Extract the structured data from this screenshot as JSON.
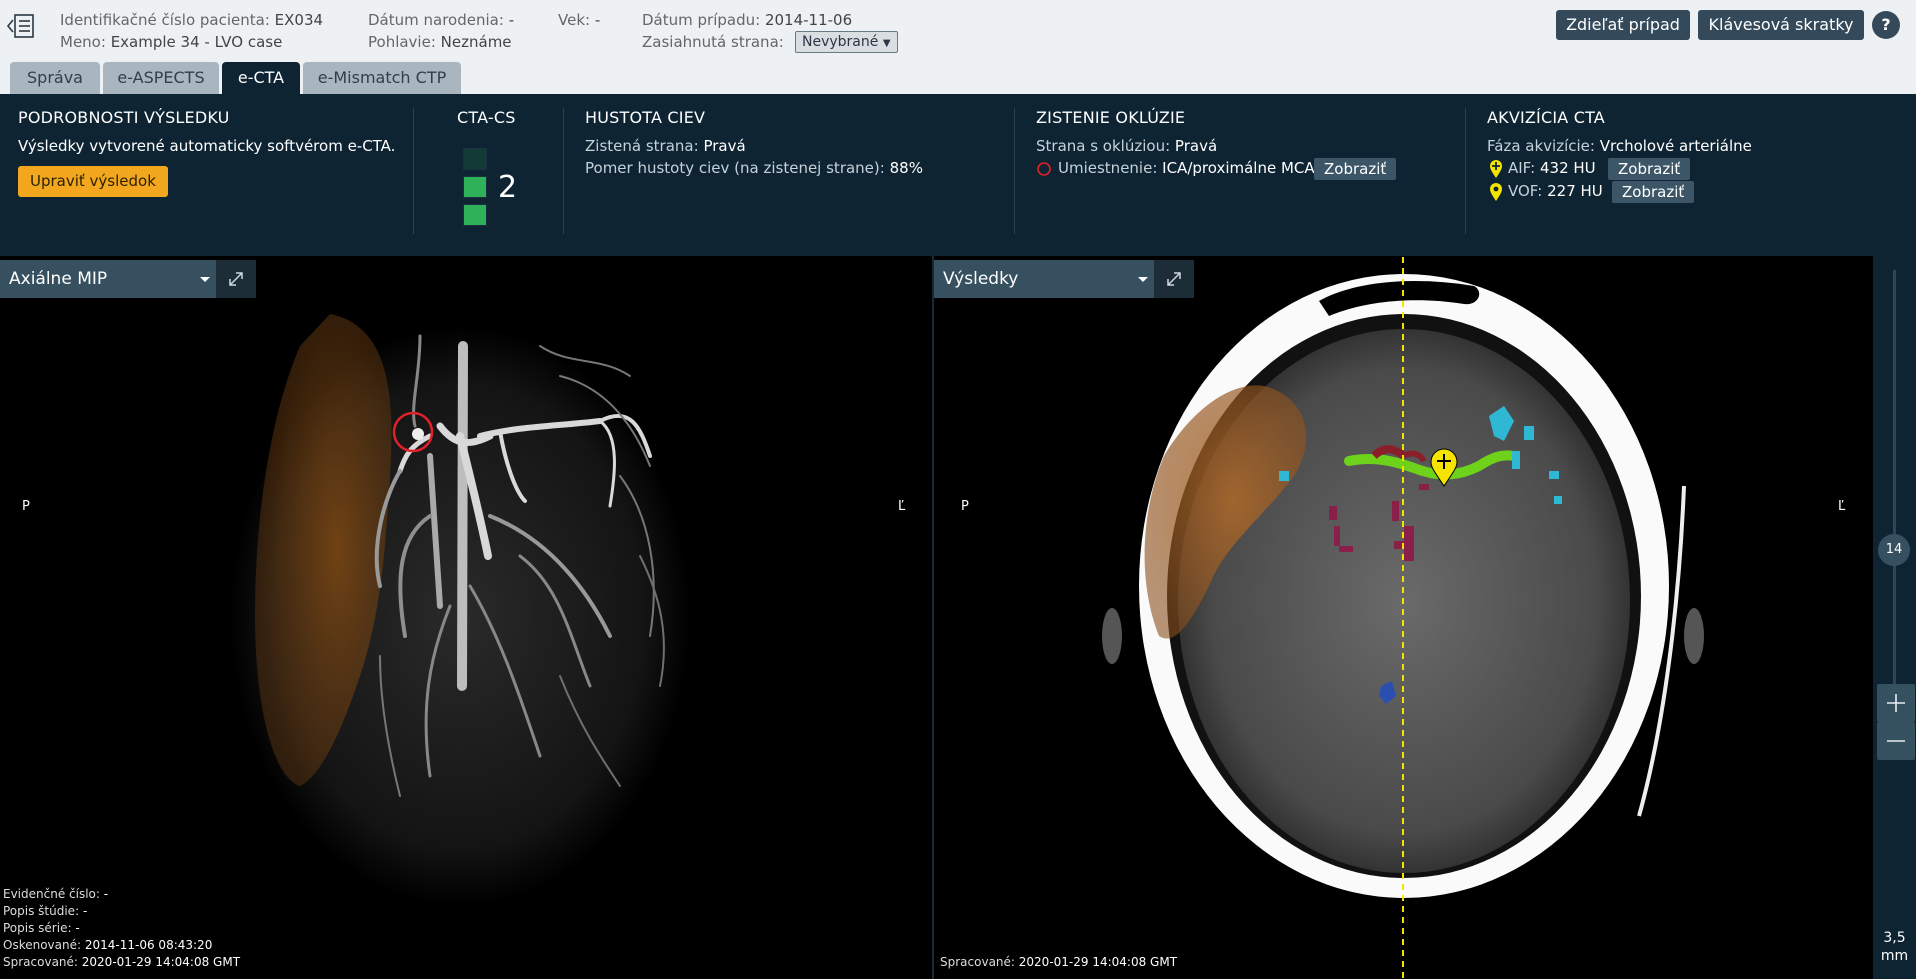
{
  "header": {
    "patient_id_label": "Identifikačné číslo pacienta:",
    "patient_id": "EX034",
    "name_label": "Meno:",
    "name": "Example 34 - LVO case",
    "dob_label": "Dátum narodenia:",
    "dob": "-",
    "sex_label": "Pohlavie:",
    "sex": "Neznáme",
    "age_label": "Vek:",
    "age": "-",
    "case_date_label": "Dátum prípadu:",
    "case_date": "2014-11-06",
    "affected_side_label": "Zasiahnutá strana:",
    "affected_side": "Nevybrané",
    "share_button": "Zdieľať prípad",
    "shortcuts_button": "Klávesová skratky",
    "help_button": "?"
  },
  "tabs": [
    {
      "label": "Správa"
    },
    {
      "label": "e-ASPECTS"
    },
    {
      "label": "e-CTA"
    },
    {
      "label": "e-Mismatch CTP"
    }
  ],
  "panel": {
    "details": {
      "title": "PODROBNOSTI VÝSLEDKU",
      "text": "Výsledky vytvorené automaticky softvérom e-CTA.",
      "edit_button": "Upraviť výsledok"
    },
    "ctacs": {
      "title": "CTA-CS",
      "score": "2",
      "boxes_filled": 2,
      "boxes_total": 3
    },
    "density": {
      "title": "HUSTOTA CIEV",
      "side_label": "Zistená strana:",
      "side_value": "Pravá",
      "ratio_label": "Pomer hustoty ciev (na zistenej strane):",
      "ratio_value": "88%"
    },
    "occlusion": {
      "title": "ZISTENIE OKLÚZIE",
      "side_label": "Strana s oklúziou:",
      "side_value": "Pravá",
      "location_label": "Umiestnenie:",
      "location_value": "ICA/proximálne MCA",
      "show_button": "Zobraziť"
    },
    "acquisition": {
      "title": "AKVIZÍCIA CTA",
      "phase_label": "Fáza akvizície:",
      "phase_value": "Vrcholové arteriálne",
      "aif_label": "AIF:",
      "aif_value": "432 HU",
      "vof_label": "VOF:",
      "vof_value": "227 HU",
      "show_button": "Zobraziť"
    }
  },
  "viewports": {
    "left": {
      "title": "Axiálne MIP",
      "orient_left": "P",
      "orient_right": "Ľ",
      "accession_label": "Evidenčné číslo:",
      "accession": "-",
      "study_label": "Popis štúdie:",
      "study": "-",
      "series_label": "Popis série:",
      "series": "-",
      "scanned_label": "Oskenované:",
      "scanned": "2014-11-06 08:43:20",
      "processed_label": "Spracované:",
      "processed": "2020-01-29 14:04:08 GMT"
    },
    "right": {
      "title": "Výsledky",
      "orient_left": "P",
      "orient_right": "Ľ",
      "processed_label": "Spracované:",
      "processed": "2020-01-29 14:04:08 GMT"
    }
  },
  "slider": {
    "slice": "14",
    "thickness_value": "3,5",
    "thickness_unit": "mm"
  },
  "colors": {
    "header_bg": "#eef1f3",
    "panel_bg": "#0e2433",
    "button_dark": "#34495a",
    "accent_orange": "#f2a71f",
    "score_green": "#2fb15a",
    "occlusion_red": "#e0202a",
    "marker_yellow": "#f5e400"
  }
}
